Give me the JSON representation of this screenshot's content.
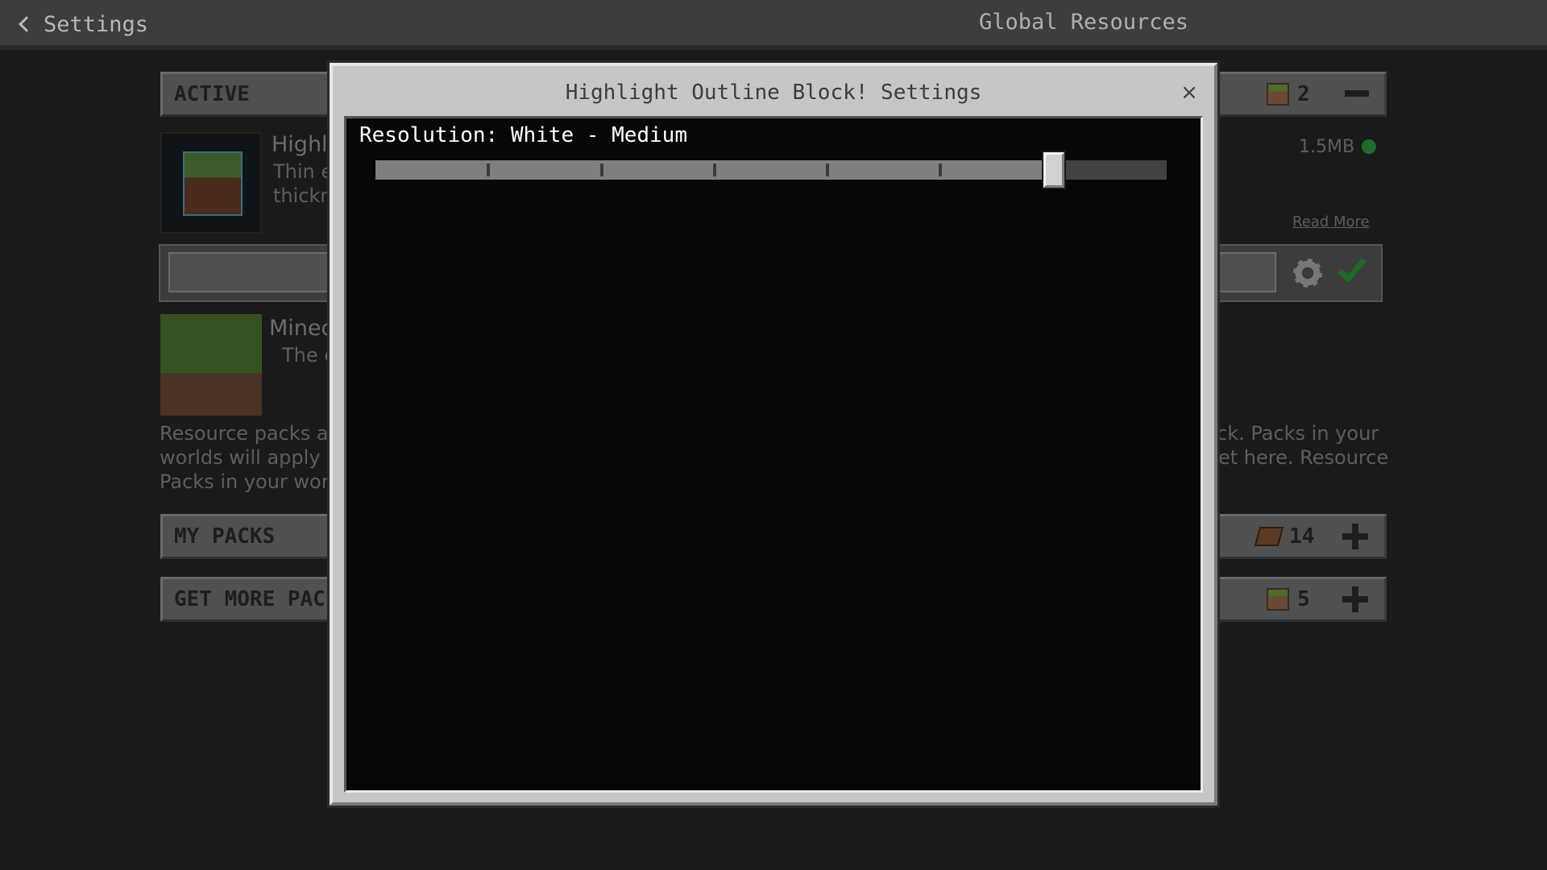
{
  "topbar": {
    "back_label": "Settings",
    "title": "Global Resources"
  },
  "active_section": {
    "label": "ACTIVE",
    "count": "2"
  },
  "active_packs": [
    {
      "name": "Highl",
      "desc_line1": "Thin e",
      "desc_line2": "thickn",
      "size": "1.5MB",
      "read_more": "Read More"
    },
    {
      "name": "Minec",
      "desc_line1": "The c"
    }
  ],
  "info_text": {
    "left_line1": "Resource packs are",
    "left_line2": "worlds will apply o",
    "left_line3": "Packs in your world",
    "right_line1": "ck. Packs in your",
    "right_line2": "et here. Resource"
  },
  "my_packs_section": {
    "label": "MY PACKS",
    "count": "14"
  },
  "get_more_section": {
    "label": "GET MORE PAC",
    "count": "5"
  },
  "modal": {
    "title": "Highlight Outline Block! Settings",
    "close_glyph": "×",
    "setting_label": "Resolution: White - Medium",
    "slider": {
      "steps": 7,
      "value_index": 6
    }
  }
}
